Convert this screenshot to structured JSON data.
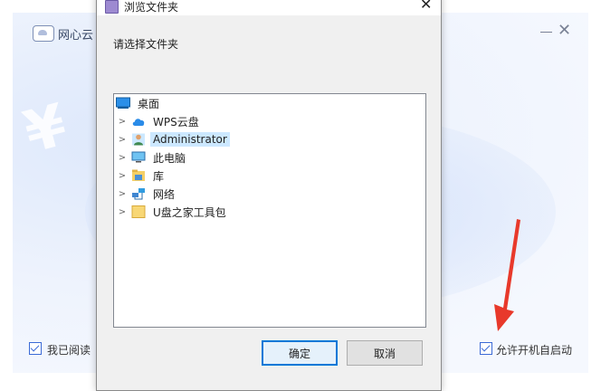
{
  "background_app": {
    "title": "网心云",
    "agree_text": "我已阅读",
    "autostart_label": "允许开机自启动",
    "yen_glyph": "¥"
  },
  "dialog": {
    "title": "浏览文件夹",
    "prompt": "请选择文件夹",
    "close_glyph": "✕",
    "tree": {
      "root": "桌面",
      "items": [
        {
          "label": "WPS云盘",
          "icon": "cloud-icon"
        },
        {
          "label": "Administrator",
          "icon": "user-folder-icon",
          "selected": true
        },
        {
          "label": "此电脑",
          "icon": "computer-icon"
        },
        {
          "label": "库",
          "icon": "library-icon"
        },
        {
          "label": "网络",
          "icon": "network-icon"
        },
        {
          "label": "U盘之家工具包",
          "icon": "folder-icon"
        }
      ]
    },
    "ok_label": "确定",
    "cancel_label": "取消"
  },
  "colors": {
    "accent": "#0078d7",
    "selection": "#cce8ff",
    "arrow": "#e8392b"
  }
}
